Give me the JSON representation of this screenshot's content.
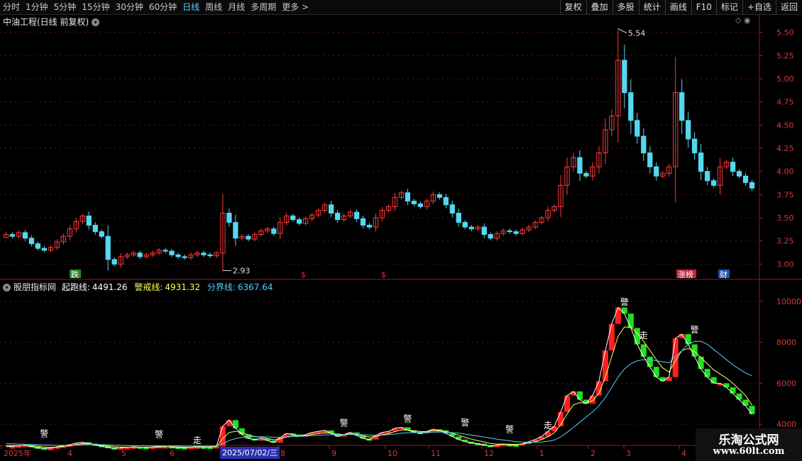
{
  "toolbar": {
    "periods": [
      "分时",
      "1分钟",
      "5分钟",
      "15分钟",
      "30分钟",
      "60分钟",
      "日线",
      "周线",
      "月线",
      "多周期",
      "更多"
    ],
    "active": "日线",
    "buttons": [
      "复权",
      "叠加",
      "多股",
      "统计",
      "画线",
      "F10",
      "标记",
      "+自选",
      "返回"
    ]
  },
  "main_panel": {
    "title": "中油工程(日线 前复权)",
    "max_label": "5.54",
    "min_label": "2.93",
    "badges": [
      {
        "text": "跌",
        "color": "#2a8a2a"
      },
      {
        "text": "$",
        "color": "#e23030"
      },
      {
        "text": "$",
        "color": "#e23030"
      },
      {
        "text": "涨榜",
        "color": "#c0203a"
      },
      {
        "text": "财",
        "color": "#2050b0"
      }
    ]
  },
  "indicator_panel": {
    "title": "股朋指标网",
    "lines": [
      {
        "name": "起跑线:",
        "value": "4491.26",
        "color": "#ffffff"
      },
      {
        "name": "警戒线:",
        "value": "4931.32",
        "color": "#ffff55"
      },
      {
        "name": "分界线:",
        "value": "6367.64",
        "color": "#55d0ff"
      }
    ],
    "signal_warn": "警",
    "signal_go": "走"
  },
  "x_axis": {
    "labels": [
      "2025年",
      "4",
      "5",
      "6",
      "7",
      "8",
      "9",
      "10",
      "11",
      "12",
      "1",
      "2",
      "3",
      "4"
    ],
    "highlight": "2025/07/02/三"
  },
  "watermark": {
    "line1": "乐淘公式网",
    "line2": "www.60lt.com"
  },
  "chart_data": [
    {
      "type": "candlestick",
      "title": "中油工程(日线 前复权)",
      "ylim": [
        2.85,
        5.62
      ],
      "yticks": [
        3.0,
        3.25,
        3.5,
        3.75,
        4.0,
        4.25,
        4.5,
        4.75,
        5.0,
        5.25,
        5.5
      ],
      "close": [
        3.32,
        3.3,
        3.34,
        3.28,
        3.22,
        3.17,
        3.15,
        3.18,
        3.24,
        3.3,
        3.38,
        3.46,
        3.52,
        3.42,
        3.35,
        3.3,
        3.05,
        3.0,
        3.08,
        3.1,
        3.12,
        3.08,
        3.1,
        3.12,
        3.15,
        3.14,
        3.1,
        3.08,
        3.07,
        3.1,
        3.12,
        3.1,
        3.09,
        3.12,
        3.55,
        3.45,
        3.28,
        3.3,
        3.27,
        3.32,
        3.36,
        3.38,
        3.33,
        3.45,
        3.52,
        3.48,
        3.44,
        3.49,
        3.53,
        3.58,
        3.64,
        3.55,
        3.48,
        3.52,
        3.56,
        3.49,
        3.42,
        3.4,
        3.5,
        3.58,
        3.62,
        3.72,
        3.77,
        3.68,
        3.65,
        3.62,
        3.68,
        3.75,
        3.72,
        3.64,
        3.55,
        3.45,
        3.4,
        3.38,
        3.4,
        3.32,
        3.28,
        3.33,
        3.36,
        3.35,
        3.33,
        3.37,
        3.4,
        3.45,
        3.5,
        3.58,
        3.62,
        3.85,
        4.05,
        4.15,
        3.98,
        3.95,
        4.05,
        4.2,
        4.45,
        4.6,
        5.2,
        4.85,
        4.55,
        4.38,
        4.2,
        4.05,
        3.95,
        3.98,
        4.05,
        4.85,
        4.55,
        4.35,
        4.2,
        4.0,
        3.9,
        3.85,
        4.05,
        4.1,
        4.0,
        3.95,
        3.88,
        3.82
      ],
      "highs": [
        {
          "value": 5.54,
          "label": "5.54"
        }
      ],
      "lows": [
        {
          "value": 2.93,
          "label": "2.93"
        }
      ]
    },
    {
      "type": "line",
      "title": "股朋指标网",
      "ylim": [
        3000,
        11000
      ],
      "yticks": [
        4000,
        6000,
        8000,
        10000
      ],
      "series": [
        {
          "name": "起跑线",
          "color": "#ffffff",
          "values": [
            2900,
            2920,
            2950,
            2980,
            2900,
            2850,
            2820,
            2830,
            2900,
            2950,
            3000,
            3080,
            3120,
            3050,
            2980,
            2930,
            2860,
            2830,
            2850,
            2870,
            2900,
            2880,
            2870,
            2890,
            2920,
            2920,
            2890,
            2870,
            2860,
            2880,
            2900,
            2890,
            2880,
            2920,
            3900,
            4200,
            3800,
            3500,
            3300,
            3250,
            3300,
            3200,
            3100,
            3350,
            3550,
            3500,
            3400,
            3500,
            3600,
            3650,
            3700,
            3550,
            3400,
            3500,
            3600,
            3450,
            3300,
            3250,
            3450,
            3600,
            3650,
            3800,
            3850,
            3700,
            3620,
            3550,
            3650,
            3750,
            3700,
            3550,
            3400,
            3250,
            3150,
            3080,
            3050,
            2980,
            2930,
            2980,
            3020,
            3000,
            2990,
            3050,
            3150,
            3250,
            3400,
            3650,
            3900,
            4600,
            5400,
            5600,
            5200,
            5000,
            5400,
            6100,
            7600,
            8900,
            9700,
            9400,
            8700,
            7900,
            7300,
            6800,
            6300,
            6100,
            6300,
            8200,
            8400,
            7900,
            7300,
            6700,
            6300,
            6000,
            6000,
            5800,
            5500,
            5200,
            4900,
            4491.26
          ]
        },
        {
          "name": "警戒线",
          "color": "#ffff55",
          "values": [
            2950,
            2950,
            2960,
            2970,
            2950,
            2920,
            2890,
            2870,
            2880,
            2910,
            2950,
            3000,
            3050,
            3040,
            3010,
            2980,
            2940,
            2900,
            2890,
            2880,
            2880,
            2880,
            2880,
            2880,
            2890,
            2900,
            2900,
            2890,
            2880,
            2880,
            2890,
            2890,
            2890,
            2900,
            3300,
            3600,
            3650,
            3580,
            3480,
            3400,
            3360,
            3300,
            3240,
            3280,
            3380,
            3420,
            3410,
            3440,
            3500,
            3540,
            3580,
            3560,
            3500,
            3500,
            3530,
            3500,
            3430,
            3370,
            3400,
            3480,
            3540,
            3640,
            3720,
            3710,
            3680,
            3640,
            3640,
            3680,
            3690,
            3640,
            3560,
            3460,
            3360,
            3270,
            3200,
            3130,
            3060,
            3030,
            3030,
            3020,
            3010,
            3030,
            3080,
            3150,
            3250,
            3400,
            3580,
            3980,
            4500,
            4950,
            5050,
            5030,
            5150,
            5500,
            6300,
            7300,
            8300,
            8750,
            8730,
            8450,
            8050,
            7600,
            7150,
            6750,
            6550,
            7100,
            7600,
            7700,
            7550,
            7250,
            6950,
            6650,
            6450,
            6250,
            6000,
            5700,
            5400,
            4931.32
          ]
        },
        {
          "name": "分界线",
          "color": "#55d0ff",
          "values": [
            3050,
            3040,
            3030,
            3020,
            3010,
            3000,
            2990,
            2980,
            2970,
            2970,
            2970,
            2980,
            3000,
            3010,
            3010,
            3000,
            2990,
            2980,
            2970,
            2960,
            2950,
            2950,
            2940,
            2940,
            2940,
            2940,
            2940,
            2940,
            2930,
            2930,
            2930,
            2930,
            2930,
            2930,
            3050,
            3200,
            3300,
            3350,
            3380,
            3390,
            3390,
            3380,
            3360,
            3360,
            3380,
            3400,
            3410,
            3420,
            3440,
            3460,
            3480,
            3490,
            3490,
            3490,
            3500,
            3500,
            3490,
            3470,
            3460,
            3470,
            3490,
            3520,
            3560,
            3580,
            3590,
            3590,
            3600,
            3610,
            3620,
            3610,
            3590,
            3560,
            3520,
            3470,
            3420,
            3370,
            3320,
            3270,
            3230,
            3190,
            3150,
            3130,
            3120,
            3120,
            3130,
            3170,
            3230,
            3380,
            3600,
            3850,
            4100,
            4350,
            4600,
            4900,
            5300,
            5800,
            6300,
            6700,
            6950,
            7100,
            7150,
            7150,
            7100,
            7050,
            7000,
            7300,
            7600,
            7900,
            8050,
            8050,
            7900,
            7650,
            7400,
            7150,
            6900,
            6700,
            6500,
            6367.64
          ]
        }
      ]
    }
  ]
}
